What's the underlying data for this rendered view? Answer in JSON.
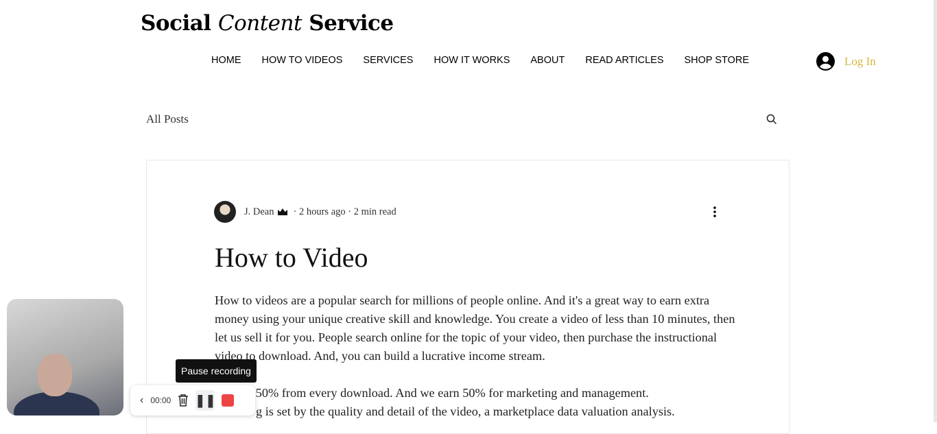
{
  "site": {
    "logo_part1": "Social ",
    "logo_part2": "Content",
    "logo_part3": " Service"
  },
  "nav": [
    "HOME",
    "HOW TO VIDEOS",
    "SERVICES",
    "HOW IT WORKS",
    "ABOUT",
    "READ ARTICLES",
    "SHOP STORE"
  ],
  "login": {
    "label": "Log In",
    "color": "#d4b93c"
  },
  "blog": {
    "all_posts": "All Posts"
  },
  "post": {
    "author": "J. Dean",
    "time": "2 hours ago",
    "read": "2 min read",
    "title": "How to Video",
    "paragraph1": "How to videos are a popular search for millions of people online. And it's a great way to earn extra money using your unique creative skill and knowledge. You create a video of less than 10 minutes, then let us sell it for you. People search online for the topic of your video, then purchase the instructional video to download. And, you can build a lucrative income stream.",
    "line2": "n 50% from every download. And we earn 50% for marketing and management.",
    "line3": "g is set by the quality and detail of the video, a marketplace data valuation analysis."
  },
  "recorder": {
    "tooltip": "Pause recording",
    "timer": "00:00",
    "stop_color": "#ee4444"
  }
}
